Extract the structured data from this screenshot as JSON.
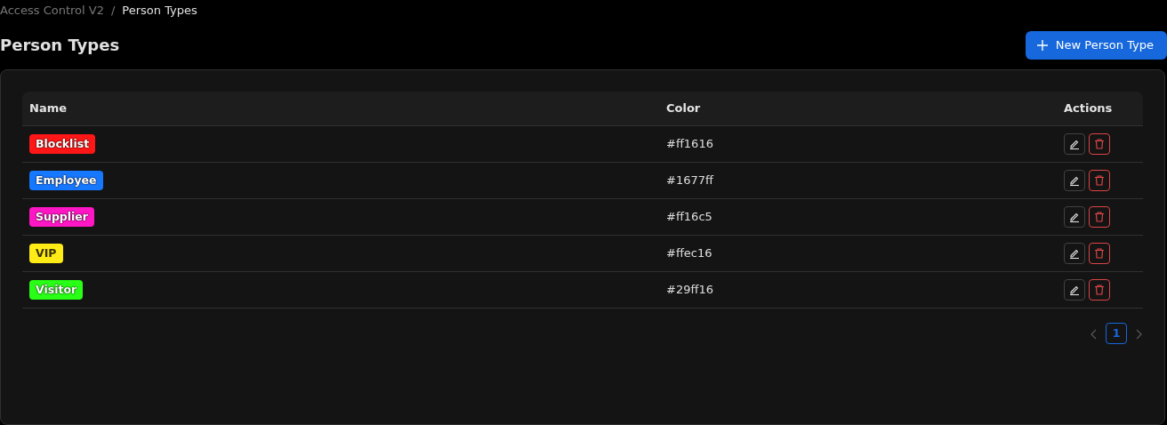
{
  "breadcrumb": [
    {
      "label": "Access Control V2",
      "selected": false
    },
    {
      "label": "Person Types",
      "selected": true
    }
  ],
  "breadcrumb_separator": "/",
  "page_title": "Person Types",
  "new_button": {
    "label": "New Person Type"
  },
  "table": {
    "columns": [
      "Name",
      "Color",
      "Actions"
    ],
    "rows": [
      {
        "name": "Blocklist",
        "color": "#ff1616",
        "color_text": "#ff1616"
      },
      {
        "name": "Employee",
        "color": "#1677ff",
        "color_text": "#1677ff"
      },
      {
        "name": "Supplier",
        "color": "#ff16c5",
        "color_text": "#ff16c5"
      },
      {
        "name": "VIP",
        "color": "#ffec16",
        "color_text": "#ffec16"
      },
      {
        "name": "Visitor",
        "color": "#29ff16",
        "color_text": "#29ff16"
      }
    ]
  },
  "pagination": {
    "pages": [
      {
        "label": "1",
        "selected": true
      }
    ]
  }
}
